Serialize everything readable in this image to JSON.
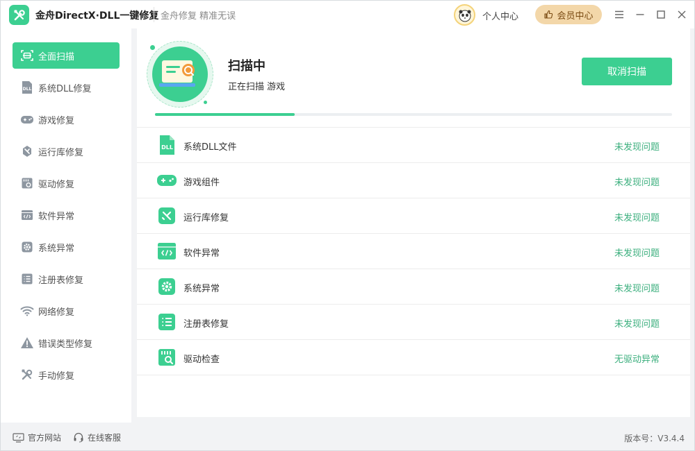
{
  "app": {
    "title": "金舟DirectX·DLL一键修复",
    "slogan": "金舟修复 精准无误",
    "personal_center": "个人中心",
    "vip_center": "会员中心"
  },
  "sidebar": {
    "items": [
      {
        "label": "全面扫描",
        "icon": "full-scan-icon",
        "active": true
      },
      {
        "label": "系统DLL修复",
        "icon": "dll-icon"
      },
      {
        "label": "游戏修复",
        "icon": "gamepad-icon"
      },
      {
        "label": "运行库修复",
        "icon": "runtime-icon"
      },
      {
        "label": "驱动修复",
        "icon": "driver-icon"
      },
      {
        "label": "软件异常",
        "icon": "code-window-icon"
      },
      {
        "label": "系统异常",
        "icon": "gear-icon"
      },
      {
        "label": "注册表修复",
        "icon": "list-icon"
      },
      {
        "label": "网络修复",
        "icon": "wifi-icon"
      },
      {
        "label": "错误类型修复",
        "icon": "warning-icon"
      },
      {
        "label": "手动修复",
        "icon": "tools-icon"
      }
    ]
  },
  "scan": {
    "title": "扫描中",
    "subtitle": "正在扫描 游戏",
    "cancel_label": "取消扫描",
    "progress": 0.27
  },
  "results": [
    {
      "label": "系统DLL文件",
      "status": "未发现问题",
      "icon": "dll-file-icon"
    },
    {
      "label": "游戏组件",
      "status": "未发现问题",
      "icon": "gamepad-icon"
    },
    {
      "label": "运行库修复",
      "status": "未发现问题",
      "icon": "runtime-icon"
    },
    {
      "label": "软件异常",
      "status": "未发现问题",
      "icon": "code-window-icon"
    },
    {
      "label": "系统异常",
      "status": "未发现问题",
      "icon": "gear-icon"
    },
    {
      "label": "注册表修复",
      "status": "未发现问题",
      "icon": "list-icon"
    },
    {
      "label": "驱动检查",
      "status": "无驱动异常",
      "icon": "driver-icon"
    }
  ],
  "footer": {
    "website": "官方网站",
    "support": "在线客服",
    "version": "版本号：V3.4.4"
  },
  "colors": {
    "accent": "#3ccf91",
    "status_ok": "#3caf7e",
    "vip_bg": "#f3d7a9"
  }
}
